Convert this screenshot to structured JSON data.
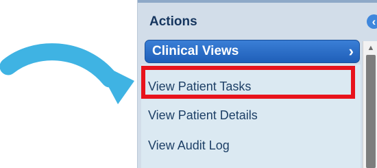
{
  "actions": {
    "title": "Actions",
    "collapse_icon": "chevron-left-circle-icon"
  },
  "clinical_views": {
    "label": "Clinical Views",
    "icon": "chevron-right-icon"
  },
  "menu": {
    "items": [
      {
        "label": "View Patient Tasks",
        "highlighted": true
      },
      {
        "label": "View Patient Details"
      },
      {
        "label": "View Audit Log"
      }
    ]
  },
  "colors": {
    "arrow": "#3fb3e3",
    "header_text": "#15355e",
    "clinical_views_bg": "#2f74cf",
    "highlight_border": "#e8131c",
    "list_bg": "#dbe9f2",
    "panel_bg": "#d2dde9"
  }
}
